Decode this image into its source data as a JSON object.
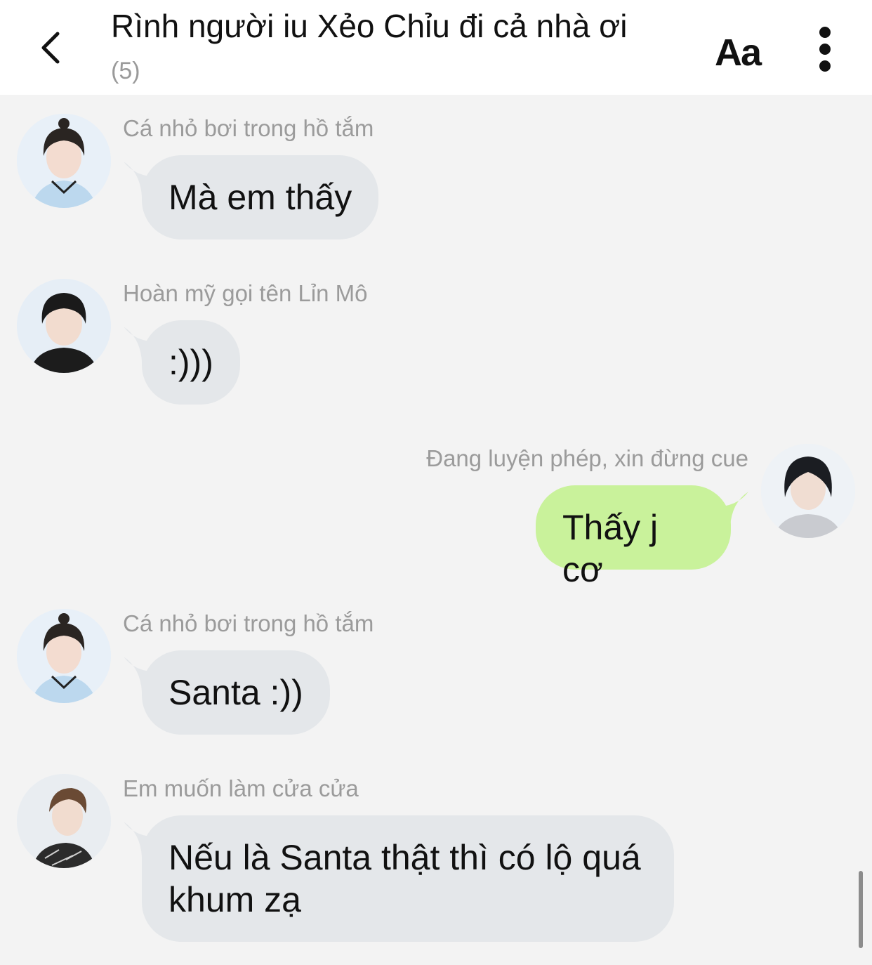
{
  "header": {
    "title": "Rình người iu Xẻo Chỉu đi cả nhà ơi",
    "member_count": "(5)",
    "font_size_label": "Aa"
  },
  "icons": {
    "back": "chevron-left-icon",
    "more": "more-vertical-icon"
  },
  "colors": {
    "incoming_bubble": "#e4e7ea",
    "outgoing_bubble": "#c9f29b",
    "background": "#f3f3f3"
  },
  "messages": [
    {
      "sender": "Cá nhỏ bơi trong hồ tắm",
      "text": "Mà em thấy",
      "direction": "incoming"
    },
    {
      "sender": "Hoàn mỹ gọi tên Lỉn Mô",
      "text": ":)))",
      "direction": "incoming"
    },
    {
      "sender": "Đang luyện phép, xin đừng cue",
      "text": "Thấy j cơ",
      "direction": "outgoing"
    },
    {
      "sender": "Cá nhỏ bơi trong hồ tắm",
      "text": "Santa :))",
      "direction": "incoming"
    },
    {
      "sender": "Em muốn làm cửa cửa",
      "text": "Nếu là Santa thật thì có lộ quá khum zạ",
      "direction": "incoming"
    }
  ]
}
